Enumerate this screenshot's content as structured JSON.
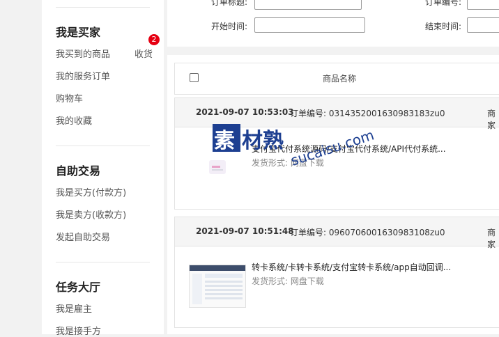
{
  "sidebar": {
    "buyer": {
      "title": "我是买家",
      "items": [
        "我买到的商品",
        "我的服务订单",
        "购物车",
        "我的收藏"
      ],
      "receive_label": "收货",
      "receive_count": "2"
    },
    "trade": {
      "title": "自助交易",
      "items": [
        "我是买方(付款方)",
        "我是卖方(收款方)",
        "发起自助交易"
      ]
    },
    "task": {
      "title": "任务大厅",
      "items": [
        "我是雇主",
        "我是接手方"
      ]
    }
  },
  "filter": {
    "order_title_label": "订单标题:",
    "order_no_label": "订单编号:",
    "start_label": "开始时间:",
    "end_label": "结束时间:"
  },
  "table": {
    "col_product": "商品名称"
  },
  "orders": [
    {
      "time": "2021-09-07 10:53:03",
      "order_no_label": "订单编号:",
      "order_no": "0314352001630983183zu0",
      "shop": "商家",
      "title": "支付宝代付系统源码/支付宝代付系统/API代付系统...",
      "ship": "发货形式:  网盘下载"
    },
    {
      "time": "2021-09-07 10:51:48",
      "order_no_label": "订单编号:",
      "order_no": "0960706001630983108zu0",
      "shop": "商家",
      "title": "转卡系统/卡转卡系统/支付宝转卡系统/app自动回调...",
      "ship": "发货形式:  网盘下载"
    }
  ],
  "watermark": {
    "text": "素材熟",
    "url": "sucaisu.com"
  }
}
